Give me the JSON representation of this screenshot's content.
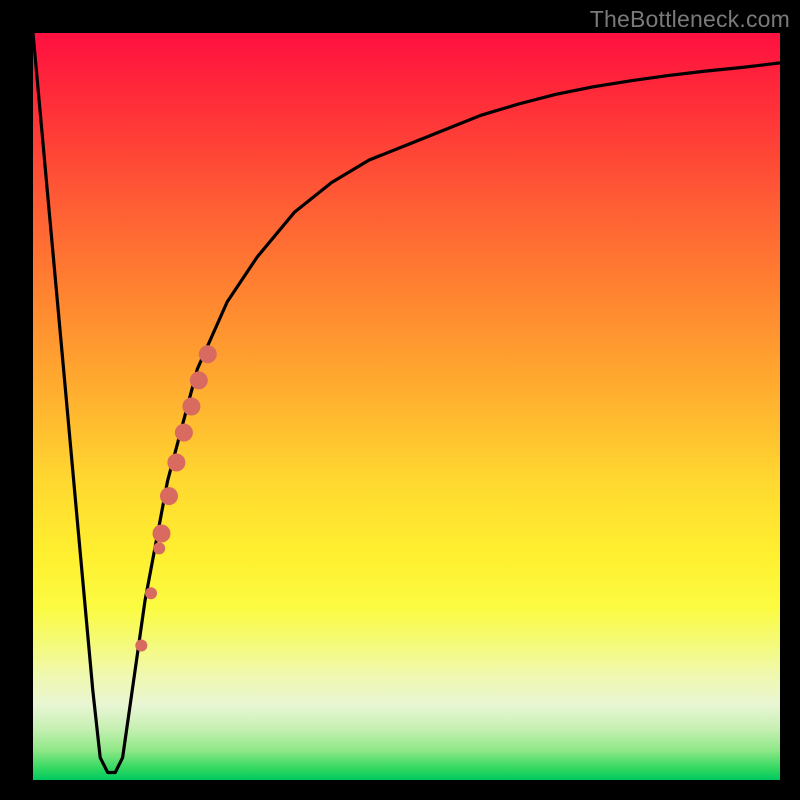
{
  "watermark": "TheBottleneck.com",
  "chart_data": {
    "type": "line",
    "title": "",
    "xlabel": "",
    "ylabel": "",
    "xlim": [
      0,
      100
    ],
    "ylim": [
      0,
      100
    ],
    "background_gradient": {
      "top": "#ff1040",
      "mid": "#fff030",
      "bottom": "#00c860"
    },
    "curve_color": "#000000",
    "series": [
      {
        "name": "bottleneck-curve",
        "x": [
          0,
          2,
          4,
          6,
          8,
          9,
          10,
          11,
          12,
          13,
          15,
          18,
          22,
          26,
          30,
          35,
          40,
          45,
          50,
          55,
          60,
          65,
          70,
          75,
          80,
          85,
          90,
          95,
          100
        ],
        "y": [
          100,
          78,
          56,
          34,
          12,
          3,
          1,
          1,
          3,
          10,
          24,
          40,
          55,
          64,
          70,
          76,
          80,
          83,
          85,
          87,
          89,
          90.5,
          91.8,
          92.8,
          93.6,
          94.3,
          94.9,
          95.4,
          96
        ]
      }
    ],
    "markers": {
      "name": "highlight-dots",
      "color": "#d86a60",
      "points": [
        {
          "x": 14.5,
          "y": 18,
          "r": 6
        },
        {
          "x": 15.8,
          "y": 25,
          "r": 6
        },
        {
          "x": 16.9,
          "y": 31,
          "r": 6
        },
        {
          "x": 17.2,
          "y": 33,
          "r": 9
        },
        {
          "x": 18.2,
          "y": 38,
          "r": 9
        },
        {
          "x": 19.2,
          "y": 42.5,
          "r": 9
        },
        {
          "x": 20.2,
          "y": 46.5,
          "r": 9
        },
        {
          "x": 21.2,
          "y": 50,
          "r": 9
        },
        {
          "x": 22.2,
          "y": 53.5,
          "r": 9
        },
        {
          "x": 23.4,
          "y": 57,
          "r": 9
        }
      ]
    }
  }
}
